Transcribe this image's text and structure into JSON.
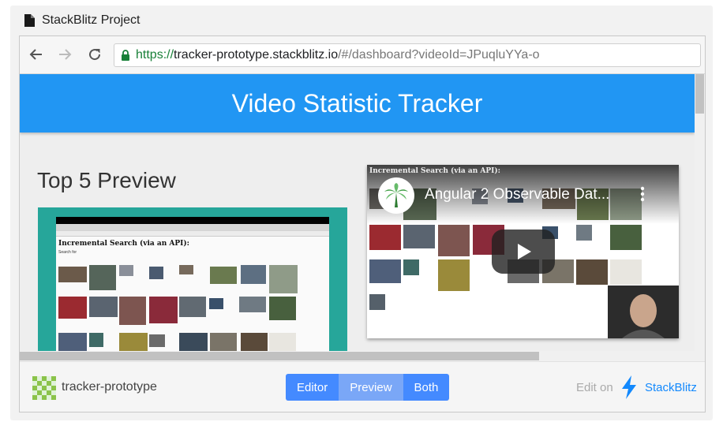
{
  "window": {
    "title": "StackBlitz Project",
    "icon": "file-icon"
  },
  "browser": {
    "url_scheme": "https://",
    "url_host": "tracker-prototype.stackblitz.io",
    "url_rest": "/#/dashboard?videoId=JPuqluYYa-o",
    "nav_icons": [
      "back-arrow-icon",
      "forward-arrow-icon",
      "reload-icon",
      "lock-icon"
    ]
  },
  "app": {
    "header_title": "Video Statistic Tracker",
    "section_title": "Top 5 Preview",
    "header_color": "#2196f3",
    "card_color": "#26a69a"
  },
  "preview_card": {
    "page_heading": "Incremental Search (via an API):",
    "search_label": "Search for"
  },
  "video": {
    "page_heading": "Incremental Search (via an API):",
    "title": "Angular 2 Observable Dat...",
    "icons": [
      "channel-palm-icon",
      "more-vert-icon",
      "play-icon"
    ]
  },
  "footer": {
    "project_name": "tracker-prototype",
    "view_buttons": [
      {
        "label": "Editor",
        "active": false
      },
      {
        "label": "Preview",
        "active": true
      },
      {
        "label": "Both",
        "active": false
      }
    ],
    "edit_on": "Edit on",
    "brand": "StackBlitz",
    "brand_color": "#1389fd"
  }
}
